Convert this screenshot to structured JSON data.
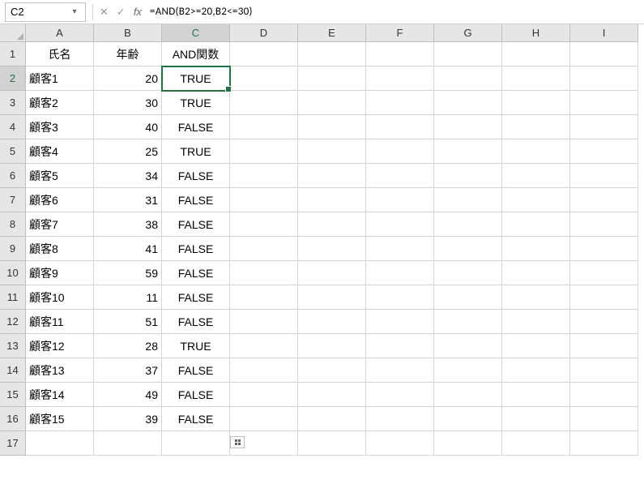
{
  "formula_bar": {
    "name_box": "C2",
    "formula": "=AND(B2>=20,B2<=30)"
  },
  "columns": [
    "A",
    "B",
    "C",
    "D",
    "E",
    "F",
    "G",
    "H",
    "I"
  ],
  "active_col_index": 2,
  "active_row": 2,
  "headers": {
    "A": "氏名",
    "B": "年齢",
    "C": "AND関数"
  },
  "rows": [
    {
      "n": "1",
      "name": "氏名",
      "age": "年齢",
      "and": "AND関数",
      "is_header": true
    },
    {
      "n": "2",
      "name": "顧客1",
      "age": "20",
      "and": "TRUE"
    },
    {
      "n": "3",
      "name": "顧客2",
      "age": "30",
      "and": "TRUE"
    },
    {
      "n": "4",
      "name": "顧客3",
      "age": "40",
      "and": "FALSE"
    },
    {
      "n": "5",
      "name": "顧客4",
      "age": "25",
      "and": "TRUE"
    },
    {
      "n": "6",
      "name": "顧客5",
      "age": "34",
      "and": "FALSE"
    },
    {
      "n": "7",
      "name": "顧客6",
      "age": "31",
      "and": "FALSE"
    },
    {
      "n": "8",
      "name": "顧客7",
      "age": "38",
      "and": "FALSE"
    },
    {
      "n": "9",
      "name": "顧客8",
      "age": "41",
      "and": "FALSE"
    },
    {
      "n": "10",
      "name": "顧客9",
      "age": "59",
      "and": "FALSE"
    },
    {
      "n": "11",
      "name": "顧客10",
      "age": "11",
      "and": "FALSE"
    },
    {
      "n": "12",
      "name": "顧客11",
      "age": "51",
      "and": "FALSE"
    },
    {
      "n": "13",
      "name": "顧客12",
      "age": "28",
      "and": "TRUE"
    },
    {
      "n": "14",
      "name": "顧客13",
      "age": "37",
      "and": "FALSE"
    },
    {
      "n": "15",
      "name": "顧客14",
      "age": "49",
      "and": "FALSE"
    },
    {
      "n": "16",
      "name": "顧客15",
      "age": "39",
      "and": "FALSE"
    },
    {
      "n": "17",
      "name": "",
      "age": "",
      "and": ""
    }
  ]
}
